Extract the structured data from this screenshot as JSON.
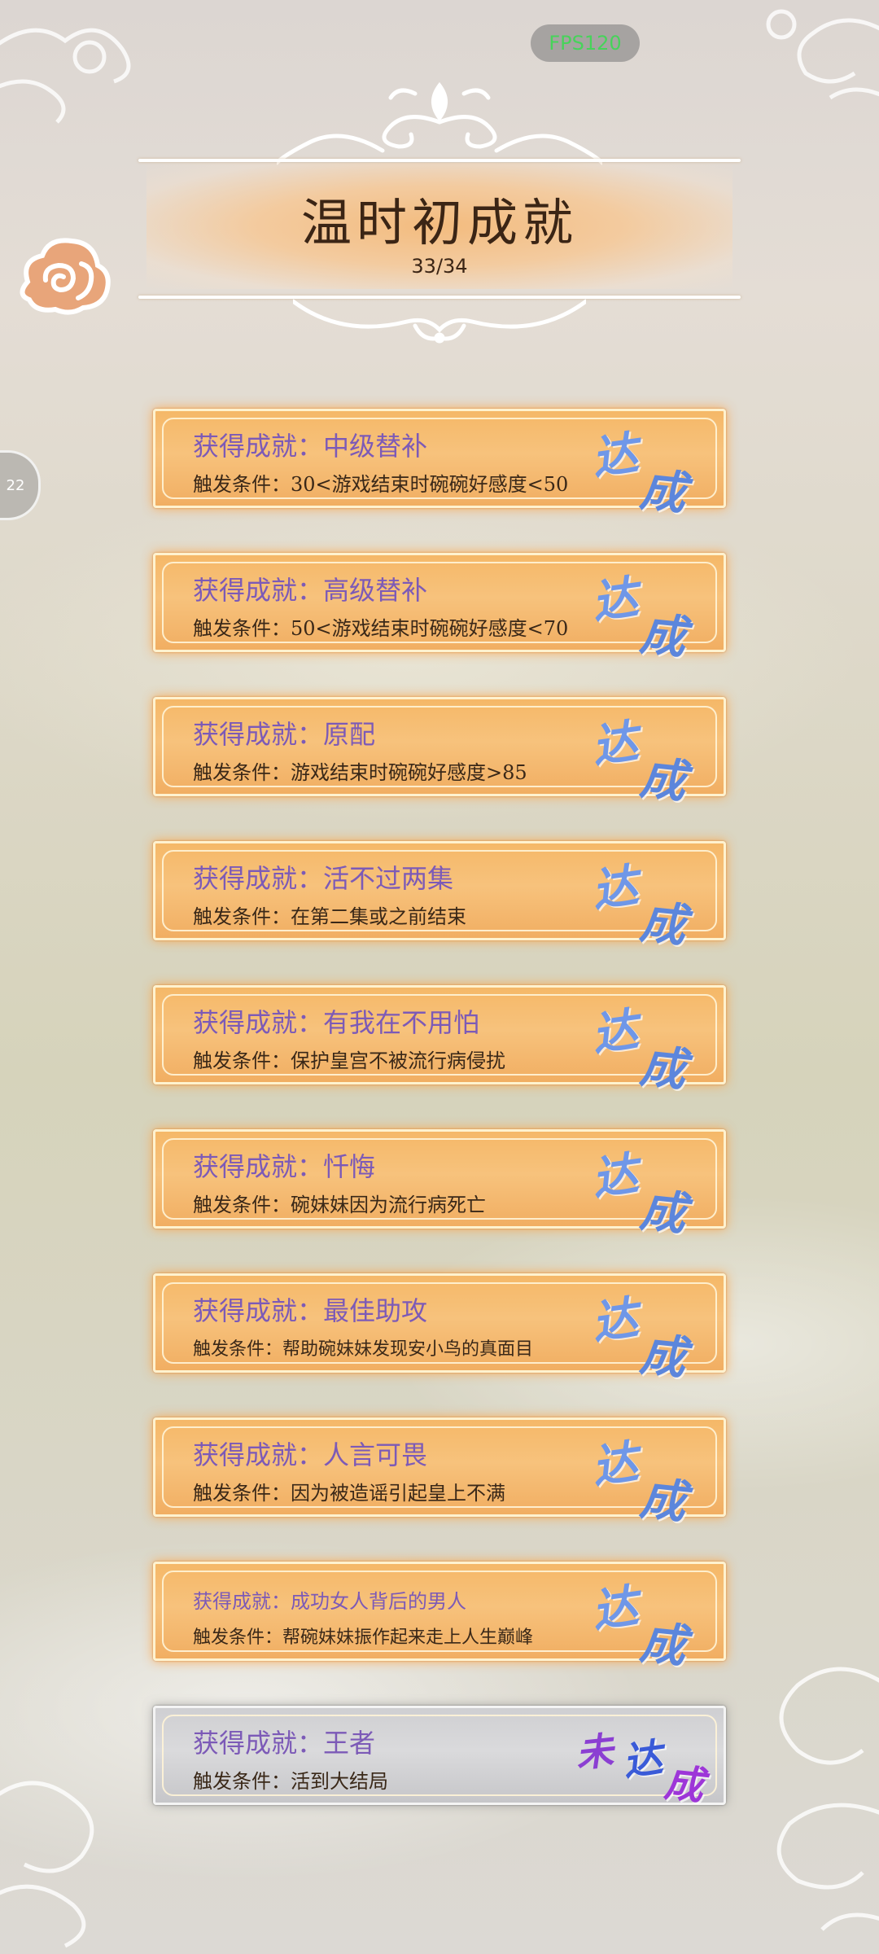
{
  "status": {
    "fps": "FPS120",
    "side_tab": "22"
  },
  "header": {
    "title": "温时初成就",
    "count": "33/34"
  },
  "stamp_done": {
    "a": "达",
    "b": "成"
  },
  "stamp_locked": {
    "w": "未",
    "a": "达",
    "b": "成"
  },
  "achievements": [
    {
      "name": "获得成就：中级替补",
      "condition": "触发条件：30<游戏结束时碗碗好感度<50",
      "achieved": true
    },
    {
      "name": "获得成就：高级替补",
      "condition": "触发条件：50<游戏结束时碗碗好感度<70",
      "achieved": true
    },
    {
      "name": "获得成就：原配",
      "condition": "触发条件：游戏结束时碗碗好感度>85",
      "achieved": true
    },
    {
      "name": "获得成就：活不过两集",
      "condition": "触发条件：在第二集或之前结束",
      "achieved": true
    },
    {
      "name": "获得成就：有我在不用怕",
      "condition": "触发条件：保护皇宫不被流行病侵扰",
      "achieved": true
    },
    {
      "name": "获得成就：忏悔",
      "condition": "触发条件：碗妹妹因为流行病死亡",
      "achieved": true
    },
    {
      "name": "获得成就：最佳助攻",
      "condition": "触发条件：帮助碗妹妹发现安小鸟的真面目",
      "achieved": true
    },
    {
      "name": "获得成就：人言可畏",
      "condition": "触发条件：因为被造谣引起皇上不满",
      "achieved": true
    },
    {
      "name": "获得成就：成功女人背后的男人",
      "condition": "触发条件：帮碗妹妹振作起来走上人生巅峰",
      "achieved": true
    },
    {
      "name": "获得成就：王者",
      "condition": "触发条件：活到大结局",
      "achieved": false
    }
  ],
  "colors": {
    "card_gold": "#f5b868",
    "card_grey": "#cfcfd2",
    "name_purple": "#7c5ab7",
    "stamp_blue": "#6f97e8"
  }
}
